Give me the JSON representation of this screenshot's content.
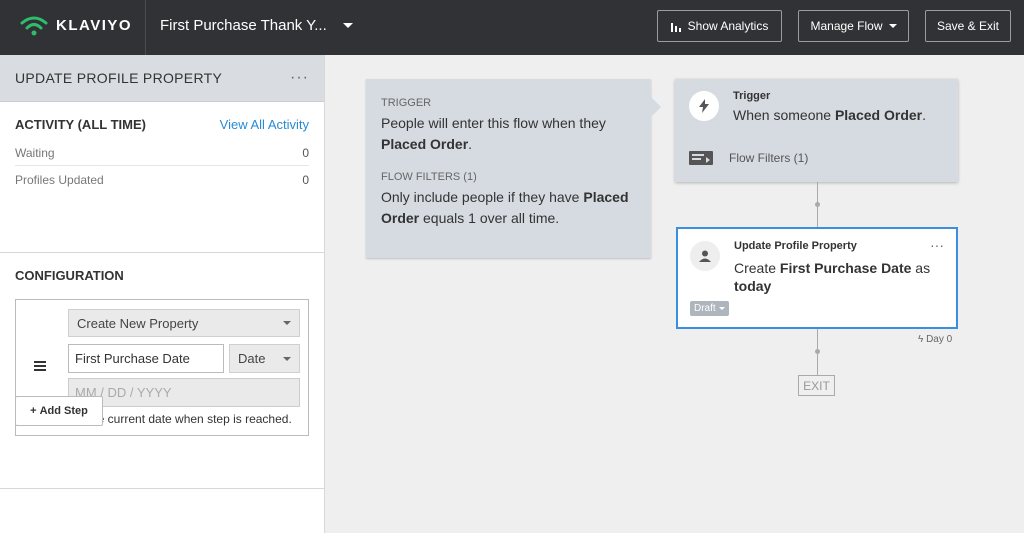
{
  "header": {
    "logo_text": "KLAVIYO",
    "flow_name": "First Purchase Thank Y...",
    "buttons": {
      "analytics": "Show Analytics",
      "manage": "Manage Flow",
      "save": "Save & Exit"
    }
  },
  "sidebar": {
    "title": "UPDATE PROFILE PROPERTY",
    "activity": {
      "title": "ACTIVITY (ALL TIME)",
      "view_all": "View All Activity",
      "rows": [
        {
          "label": "Waiting",
          "value": "0"
        },
        {
          "label": "Profiles Updated",
          "value": "0"
        }
      ]
    },
    "configuration": {
      "title": "CONFIGURATION",
      "action_select": "Create New Property",
      "property_name": "First Purchase Date",
      "type_select": "Date",
      "date_placeholder": "MM / DD / YYYY",
      "checkbox_label": "Use current date when step is reached.",
      "checkbox_checked": true
    },
    "add_step": "Add Step"
  },
  "canvas": {
    "trigger_panel": {
      "trigger_label": "TRIGGER",
      "trigger_text_1": "People will enter this flow when they",
      "trigger_text_bold": "Placed Order",
      "trigger_text_end": ".",
      "filters_label": "FLOW FILTERS (1)",
      "filters_text_1": "Only include people if they have",
      "filters_text_bold": "Placed Order",
      "filters_text_2": " equals 1 over all time."
    },
    "trigger_card": {
      "label": "Trigger",
      "text_pre": "When someone ",
      "text_bold": "Placed Order",
      "text_post": ".",
      "filters": "Flow Filters (1)"
    },
    "action_card": {
      "label": "Update Profile Property",
      "text_pre": "Create ",
      "text_bold": "First Purchase Date",
      "text_mid": " as",
      "text_bold_2": "today",
      "status": "Draft"
    },
    "delay": "Day 0",
    "exit": "EXIT"
  },
  "colors": {
    "topbar": "#303235",
    "accent_green": "#2ebd6b",
    "link_blue": "#2a8bd4",
    "selected_border": "#3b8fe0"
  }
}
